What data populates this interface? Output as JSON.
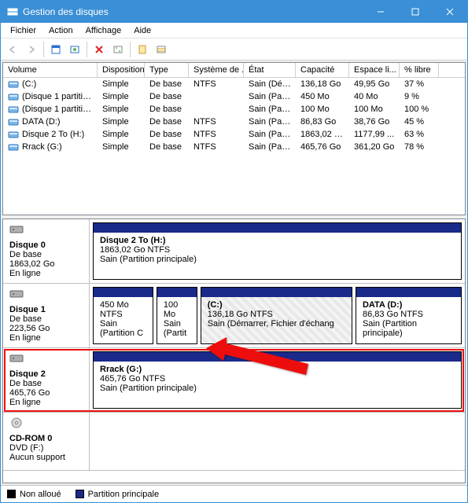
{
  "window": {
    "title": "Gestion des disques"
  },
  "menu": {
    "file": "Fichier",
    "action": "Action",
    "view": "Affichage",
    "help": "Aide"
  },
  "columns": {
    "volume": "Volume",
    "disposition": "Disposition",
    "type": "Type",
    "system": "Système de ...",
    "state": "État",
    "capacity": "Capacité",
    "free": "Espace li...",
    "pct": "% libre"
  },
  "volumes": [
    {
      "name": "(C:)",
      "disp": "Simple",
      "type": "De base",
      "sys": "NTFS",
      "state": "Sain (Dém...",
      "cap": "136,18 Go",
      "free": "49,95 Go",
      "pct": "37 %"
    },
    {
      "name": "(Disque 1 partition...",
      "disp": "Simple",
      "type": "De base",
      "sys": "",
      "state": "Sain (Parti...",
      "cap": "450 Mo",
      "free": "40 Mo",
      "pct": "9 %"
    },
    {
      "name": "(Disque 1 partition...",
      "disp": "Simple",
      "type": "De base",
      "sys": "",
      "state": "Sain (Parti...",
      "cap": "100 Mo",
      "free": "100 Mo",
      "pct": "100 %"
    },
    {
      "name": "DATA (D:)",
      "disp": "Simple",
      "type": "De base",
      "sys": "NTFS",
      "state": "Sain (Parti...",
      "cap": "86,83 Go",
      "free": "38,76 Go",
      "pct": "45 %"
    },
    {
      "name": "Disque 2 To (H:)",
      "disp": "Simple",
      "type": "De base",
      "sys": "NTFS",
      "state": "Sain (Parti...",
      "cap": "1863,02 Go",
      "free": "1177,99 ...",
      "pct": "63 %"
    },
    {
      "name": "Rrack (G:)",
      "disp": "Simple",
      "type": "De base",
      "sys": "NTFS",
      "state": "Sain (Parti...",
      "cap": "465,76 Go",
      "free": "361,20 Go",
      "pct": "78 %"
    }
  ],
  "disks": [
    {
      "name": "Disque 0",
      "kind": "De base",
      "size": "1863,02 Go",
      "status": "En ligne",
      "icon": "disk",
      "parts": [
        {
          "name": "Disque 2 To  (H:)",
          "l2": "1863,02 Go NTFS",
          "l3": "Sain (Partition principale)",
          "flex": 1
        }
      ]
    },
    {
      "name": "Disque 1",
      "kind": "De base",
      "size": "223,56 Go",
      "status": "En ligne",
      "icon": "disk",
      "parts": [
        {
          "name": "",
          "l2": "450 Mo NTFS",
          "l3": "Sain (Partition C",
          "flex": 0.9
        },
        {
          "name": "",
          "l2": "100 Mo",
          "l3": "Sain (Partit",
          "flex": 0.6
        },
        {
          "name": "(C:)",
          "l2": "136,18 Go NTFS",
          "l3": "Sain (Démarrer, Fichier d'échang",
          "flex": 2.3,
          "selected": true
        },
        {
          "name": "DATA  (D:)",
          "l2": "86,83 Go NTFS",
          "l3": "Sain (Partition principale)",
          "flex": 1.6
        }
      ]
    },
    {
      "name": "Disque 2",
      "kind": "De base",
      "size": "465,76 Go",
      "status": "En ligne",
      "icon": "disk",
      "highlight": true,
      "parts": [
        {
          "name": "Rrack  (G:)",
          "l2": "465,76 Go NTFS",
          "l3": "Sain (Partition principale)",
          "flex": 1
        }
      ]
    },
    {
      "name": "CD-ROM 0",
      "kind": "DVD (F:)",
      "size": "",
      "status": "Aucun support",
      "icon": "cdrom",
      "parts": []
    }
  ],
  "legend": {
    "unalloc": "Non alloué",
    "primary": "Partition principale"
  }
}
